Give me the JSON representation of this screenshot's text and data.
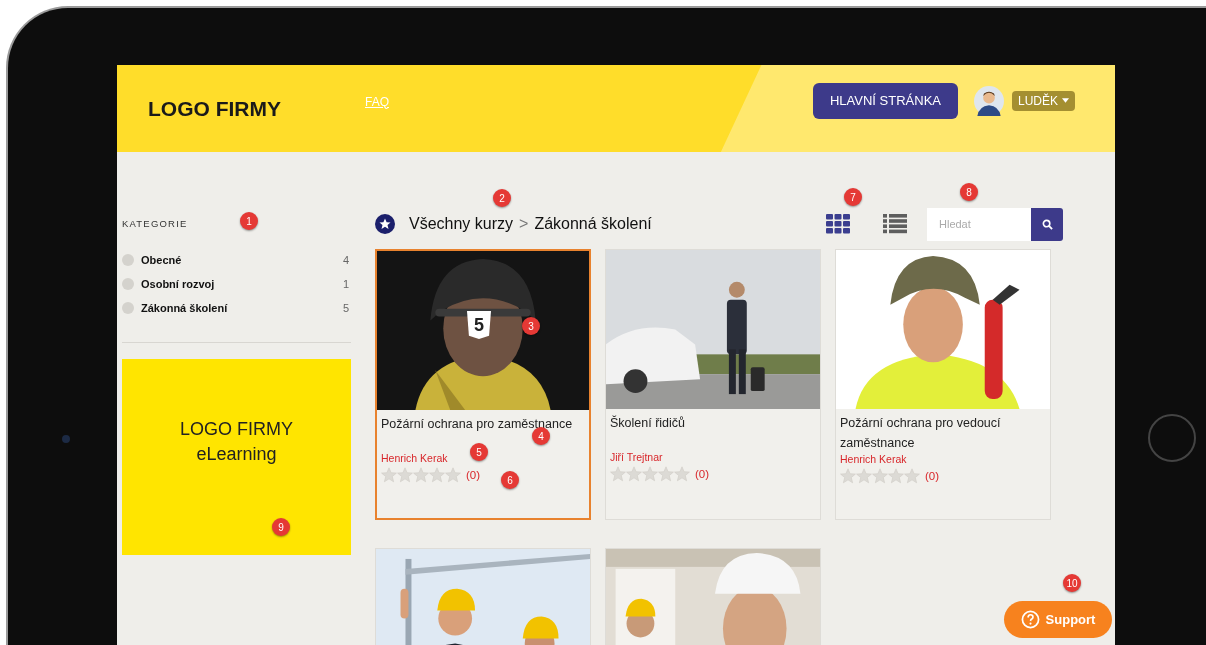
{
  "header": {
    "logo": "LOGO FIRMY",
    "nav": [
      {
        "label": "FAQ"
      }
    ],
    "home_button": "HLAVNÍ STRÁNKA",
    "user": {
      "name": "LUDĚK"
    }
  },
  "sidebar": {
    "heading": "KATEGORIE",
    "categories": [
      {
        "name": "Obecné",
        "count": "4"
      },
      {
        "name": "Osobní rozvoj",
        "count": "1"
      },
      {
        "name": "Zákonná školení",
        "count": "5"
      }
    ],
    "promo": {
      "lines": [
        "LOGO FIRMY",
        "eLearning"
      ]
    }
  },
  "toolbar": {
    "breadcrumb": [
      "Všechny kurzy",
      "Zákonná školení"
    ],
    "separator": ">",
    "views": [
      {
        "kind": "grid",
        "selected": true
      },
      {
        "kind": "list",
        "selected": false
      }
    ],
    "search": {
      "placeholder": "Hledat"
    }
  },
  "courses": [
    {
      "title": "Požární ochrana pro zaměstnance",
      "author": "Henrich Kerak",
      "stars": 0,
      "reviews": "(0)",
      "selected": true,
      "badge": "5"
    },
    {
      "title": "Školení řidičů",
      "author": "Jiří Trejtnar",
      "stars": 0,
      "reviews": "(0)",
      "selected": false
    },
    {
      "title": "Požární ochrana pro vedoucí zaměstnance",
      "author": "Henrich Kerak",
      "stars": 0,
      "reviews": "(0)",
      "selected": false
    },
    {
      "selected": false
    },
    {
      "selected": false
    }
  ],
  "support": {
    "label": "Support"
  },
  "callouts": [
    "1",
    "2",
    "3",
    "4",
    "5",
    "6",
    "7",
    "8",
    "9",
    "10"
  ]
}
